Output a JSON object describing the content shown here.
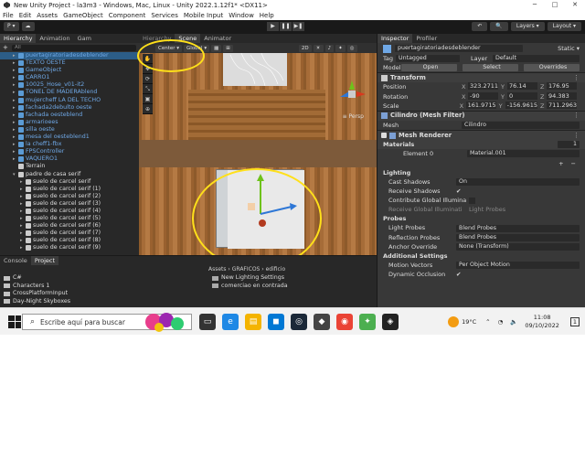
{
  "window": {
    "title": "New Unity Project - la3m3 - Windows, Mac, Linux - Unity 2022.1.12f1* <DX11>",
    "controls": [
      "─",
      "□",
      "✕"
    ]
  },
  "menu": [
    "File",
    "Edit",
    "Assets",
    "GameObject",
    "Component",
    "Services",
    "Mobile Input",
    "Window",
    "Help"
  ],
  "toolbar": {
    "account": "P ▾",
    "cloud": "☁",
    "play": "▶",
    "pause": "❚❚",
    "step": "▶❚",
    "history": "↶",
    "search": "🔍",
    "layers": "Layers ▾",
    "layout": "Layout ▾"
  },
  "hierarchy": {
    "tabs": [
      "Hierarchy",
      "Animation",
      "Gam"
    ],
    "search_placeholder": "All",
    "items": [
      {
        "label": "puertagiratoriadesdeblender",
        "type": "prefab",
        "arrow": "▸",
        "selected": true
      },
      {
        "label": "TEXTO OESTE",
        "type": "prefab",
        "arrow": "▸"
      },
      {
        "label": "GameObject",
        "type": "prefab",
        "arrow": "▸"
      },
      {
        "label": "CARRO1",
        "type": "prefab",
        "arrow": "▸"
      },
      {
        "label": "10025_Hose_v01-it2",
        "type": "prefab",
        "arrow": "▸"
      },
      {
        "label": "TONEL DE MADERAblend",
        "type": "prefab",
        "arrow": "▸"
      },
      {
        "label": "mujercheff LA DEL TECHO",
        "type": "prefab",
        "arrow": "▸"
      },
      {
        "label": "fachada2debulto oeste",
        "type": "prefab",
        "arrow": "▸"
      },
      {
        "label": "fachada oesteblend",
        "type": "prefab",
        "arrow": "▸"
      },
      {
        "label": "armarioees",
        "type": "prefab",
        "arrow": "▸"
      },
      {
        "label": "silla oeste",
        "type": "prefab",
        "arrow": "▸"
      },
      {
        "label": "mesa del oesteblend1",
        "type": "prefab",
        "arrow": "▸"
      },
      {
        "label": "la cheff1-fbx",
        "type": "prefab",
        "arrow": "▸"
      },
      {
        "label": "FPSController",
        "type": "prefab",
        "arrow": "▸"
      },
      {
        "label": "VAQUERO1",
        "type": "prefab",
        "arrow": "▸"
      },
      {
        "label": "Terrain",
        "type": "plain",
        "arrow": ""
      },
      {
        "label": "padre de casa serif",
        "type": "plain",
        "arrow": "▾"
      },
      {
        "label": "suelo de carcel serif",
        "type": "plain",
        "arrow": "▸"
      },
      {
        "label": "suelo de carcel serif (1)",
        "type": "plain",
        "arrow": "▸"
      },
      {
        "label": "suelo de carcel serif (2)",
        "type": "plain",
        "arrow": "▸"
      },
      {
        "label": "suelo de carcel serif (3)",
        "type": "plain",
        "arrow": "▸"
      },
      {
        "label": "suelo de carcel serif (4)",
        "type": "plain",
        "arrow": "▸"
      },
      {
        "label": "suelo de carcel serif (5)",
        "type": "plain",
        "arrow": "▸"
      },
      {
        "label": "suelo de carcel serif (6)",
        "type": "plain",
        "arrow": "▸"
      },
      {
        "label": "suelo de carcel serif (7)",
        "type": "plain",
        "arrow": "▸"
      },
      {
        "label": "suelo de carcel serif (8)",
        "type": "plain",
        "arrow": "▸"
      },
      {
        "label": "suelo de carcel serif (9)",
        "type": "plain",
        "arrow": "▸"
      }
    ]
  },
  "scene": {
    "tabs": [
      "Scene",
      "Animator"
    ],
    "ghost_tab": "Hierarchy",
    "pivot": "Center ▾",
    "space": "Global ▾",
    "mode_2d": "2D",
    "persp": "≡ Persp",
    "tools": [
      "✋",
      "✥",
      "⟳",
      "⤡",
      "▣",
      "⊕"
    ]
  },
  "project": {
    "tabs": [
      "Console",
      "Project"
    ],
    "tree": [
      "C#",
      "Characters 1",
      "CrossPlatformInput",
      "Day-Night Skyboxes"
    ],
    "breadcrumb": "Assets › GRAFICOS › edificio",
    "files": [
      "New Lighting Settings",
      "comerciao en contrada"
    ]
  },
  "inspector": {
    "tabs": [
      "Inspector",
      "Profiler"
    ],
    "object_name": "puertagiratoriadesdeblender",
    "static_label": "Static ▾",
    "tag_label": "Tag",
    "tag": "Untagged",
    "layer_label": "Layer",
    "layer": "Default",
    "model_label": "Model",
    "open": "Open",
    "select": "Select",
    "overrides": "Overrides",
    "transform": {
      "title": "Transform",
      "rows": [
        {
          "label": "Position",
          "x": "323.2711",
          "y": "76.14",
          "z": "176.95"
        },
        {
          "label": "Rotation",
          "x": "-90",
          "y": "0",
          "z": "94.383"
        },
        {
          "label": "Scale",
          "x": "161.9715",
          "y": "-156.9615",
          "z": "711.2963"
        }
      ]
    },
    "meshfilter": {
      "title": "Cilindro (Mesh Filter)",
      "mesh_label": "Mesh",
      "mesh": "Cilindro"
    },
    "meshrenderer": {
      "title": "Mesh Renderer"
    },
    "materials": {
      "label": "Materials",
      "count": "1",
      "element_label": "Element 0",
      "element": "Material.001",
      "plus": "+",
      "minus": "−"
    },
    "lighting": {
      "label": "Lighting",
      "cast_label": "Cast Shadows",
      "cast": "On",
      "receive_label": "Receive Shadows",
      "contrib_label": "Contribute Global Illumina",
      "rgi_label": "Receive Global Illuminati",
      "rgi": "Light Probes"
    },
    "probes": {
      "label": "Probes",
      "light_label": "Light Probes",
      "light": "Blend Probes",
      "refl_label": "Reflection Probes",
      "refl": "Blend Probes",
      "anchor_label": "Anchor Override",
      "anchor": "None (Transform)"
    },
    "additional": {
      "label": "Additional Settings",
      "motion_label": "Motion Vectors",
      "motion": "Per Object Motion",
      "dyn_label": "Dynamic Occlusion"
    }
  },
  "taskbar": {
    "search_placeholder": "Escribe aquí para buscar",
    "temp": "19°C",
    "time": "11:08",
    "date": "09/10/2022",
    "notif": "1"
  }
}
